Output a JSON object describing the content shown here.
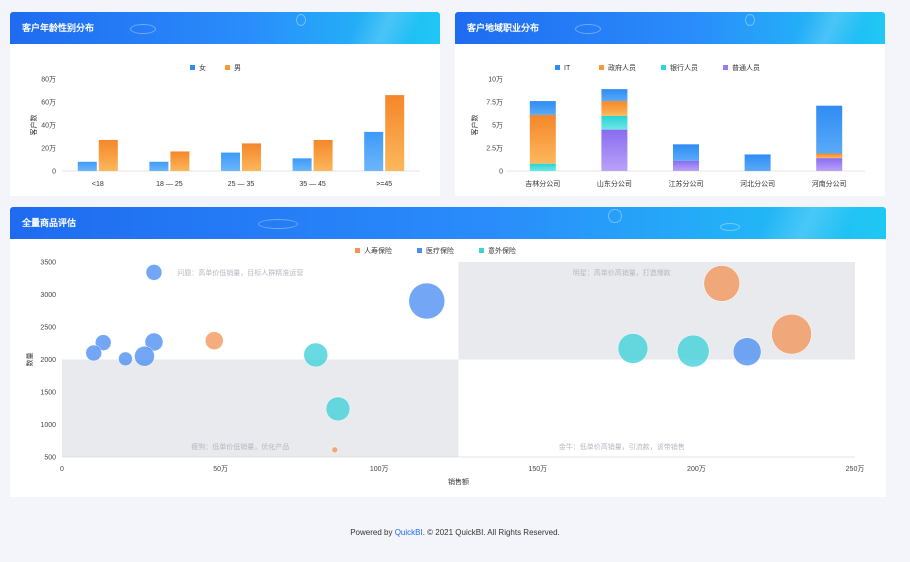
{
  "footer": {
    "prefix": "Powered by ",
    "brand": "QuickBI",
    "suffix": ". © 2021 QuickBI. All Rights Reserved."
  },
  "colors": {
    "female": "#2f8cf3",
    "male": "#f79a37",
    "it": "#2f8cf3",
    "gov": "#f79a37",
    "bank": "#2ed6d6",
    "general": "#9a7cf2",
    "life": "#f2955a",
    "medical": "#4b8ef2",
    "accident": "#3fcfd9"
  },
  "chart_data": [
    {
      "type": "bar",
      "title": "客户年龄性别分布",
      "ylabel": "客户数",
      "categories": [
        "<18",
        "18 — 25",
        "25 — 35",
        "35 — 45",
        ">=45"
      ],
      "series": [
        {
          "name": "女",
          "values": [
            8,
            8,
            16,
            11,
            34
          ]
        },
        {
          "name": "男",
          "values": [
            27,
            17,
            24,
            27,
            66
          ]
        }
      ],
      "ylim": [
        0,
        80
      ],
      "yticks": [
        "0",
        "20万",
        "40万",
        "60万",
        "80万"
      ],
      "grid": false,
      "legend": "top-center"
    },
    {
      "type": "bar",
      "stacked": true,
      "title": "客户地域职业分布",
      "ylabel": "客户数",
      "categories": [
        "吉林分公司",
        "山东分公司",
        "江苏分公司",
        "河北分公司",
        "河南分公司"
      ],
      "series": [
        {
          "name": "IT",
          "values": [
            1.5,
            1.3,
            1.8,
            1.8,
            5.2
          ]
        },
        {
          "name": "政府人员",
          "values": [
            5.3,
            1.6,
            0,
            0,
            0.5
          ]
        },
        {
          "name": "银行人员",
          "values": [
            0.8,
            1.5,
            0,
            0,
            0
          ]
        },
        {
          "name": "普通人员",
          "values": [
            0,
            4.5,
            1.1,
            0,
            1.4
          ]
        }
      ],
      "ylim": [
        0,
        10
      ],
      "yticks": [
        "0",
        "2.5万",
        "5万",
        "7.5万",
        "10万"
      ],
      "grid": false,
      "legend": "top-center"
    },
    {
      "type": "scatter",
      "bubble": true,
      "title": "全量商品评估",
      "xlabel": "销售额",
      "ylabel": "数量",
      "xlim": [
        0,
        250
      ],
      "ylim": [
        500,
        3500
      ],
      "xticks": [
        "0",
        "50万",
        "100万",
        "150万",
        "200万",
        "250万"
      ],
      "yticks": [
        "500",
        "1000",
        "1500",
        "2000",
        "2500",
        "3000",
        "3500"
      ],
      "grid": false,
      "legend": "top-center",
      "quadrant_split": {
        "x": 125,
        "y": 2000
      },
      "quadrant_labels": [
        "问题：高单价低销量，目标人群精准运营",
        "明星：高单价高销量，打造爆款",
        "瘦狗：低单价低销量，优化产品",
        "金牛：低单价高销量，引流款，该带销售"
      ],
      "series": [
        {
          "name": "人寿保险",
          "points": [
            {
              "x": 48,
              "y": 2290,
              "r": 9
            },
            {
              "x": 86,
              "y": 610,
              "r": 3
            },
            {
              "x": 208,
              "y": 3170,
              "r": 18
            },
            {
              "x": 230,
              "y": 2390,
              "r": 20
            }
          ]
        },
        {
          "name": "医疗保险",
          "points": [
            {
              "x": 29,
              "y": 3340,
              "r": 8
            },
            {
              "x": 115,
              "y": 2900,
              "r": 18
            },
            {
              "x": 13,
              "y": 2260,
              "r": 8
            },
            {
              "x": 29,
              "y": 2270,
              "r": 9
            },
            {
              "x": 10,
              "y": 2100,
              "r": 8
            },
            {
              "x": 20,
              "y": 2010,
              "r": 7
            },
            {
              "x": 26,
              "y": 2050,
              "r": 10
            },
            {
              "x": 216,
              "y": 2120,
              "r": 14
            }
          ]
        },
        {
          "name": "意外保险",
          "points": [
            {
              "x": 80,
              "y": 2070,
              "r": 12
            },
            {
              "x": 87,
              "y": 1240,
              "r": 12
            },
            {
              "x": 180,
              "y": 2170,
              "r": 15
            },
            {
              "x": 199,
              "y": 2130,
              "r": 16
            }
          ]
        }
      ]
    }
  ]
}
